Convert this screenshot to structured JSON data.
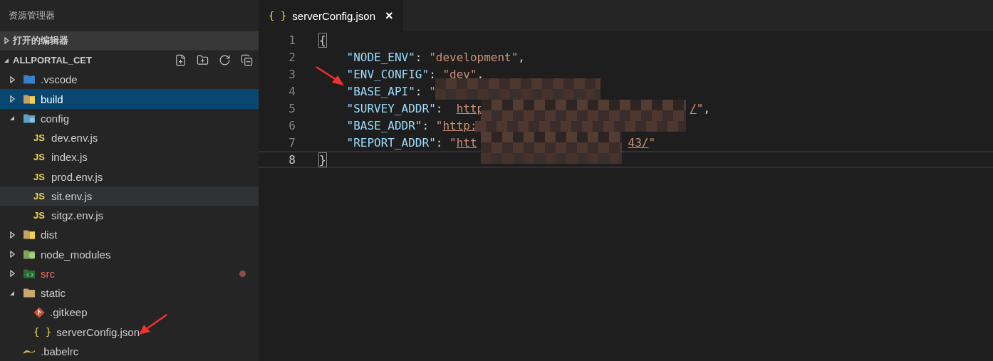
{
  "sidebar": {
    "title": "资源管理器",
    "sections": [
      {
        "label": "打开的编辑器",
        "expanded": false
      },
      {
        "label": "ALLPORTAL_CET",
        "expanded": true
      }
    ],
    "tree": [
      {
        "label": ".vscode",
        "kind": "vscode",
        "expanded": false,
        "selected": false,
        "hover": false,
        "modified": false
      },
      {
        "label": "build",
        "kind": "build",
        "expanded": false,
        "selected": true,
        "hover": false,
        "modified": false
      },
      {
        "label": "config",
        "kind": "config",
        "expanded": true,
        "selected": false,
        "hover": false,
        "modified": false,
        "children": [
          {
            "label": "dev.env.js",
            "kind": "js",
            "badge": "JS",
            "selected": false,
            "hover": false,
            "modified": false
          },
          {
            "label": "index.js",
            "kind": "js",
            "badge": "JS",
            "selected": false,
            "hover": false,
            "modified": false
          },
          {
            "label": "prod.env.js",
            "kind": "js",
            "badge": "JS",
            "selected": false,
            "hover": false,
            "modified": false
          },
          {
            "label": "sit.env.js",
            "kind": "js",
            "badge": "JS",
            "selected": false,
            "hover": true,
            "modified": false
          },
          {
            "label": "sitgz.env.js",
            "kind": "js",
            "badge": "JS",
            "selected": false,
            "hover": false,
            "modified": false
          }
        ]
      },
      {
        "label": "dist",
        "kind": "build",
        "expanded": false,
        "selected": false,
        "hover": false,
        "modified": false
      },
      {
        "label": "node_modules",
        "kind": "node",
        "expanded": false,
        "selected": false,
        "hover": false,
        "modified": false
      },
      {
        "label": "src",
        "kind": "src",
        "expanded": false,
        "selected": false,
        "hover": false,
        "modified": true
      },
      {
        "label": "static",
        "kind": "folder",
        "expanded": true,
        "selected": false,
        "hover": false,
        "modified": false,
        "children": [
          {
            "label": ".gitkeep",
            "kind": "git",
            "selected": false,
            "hover": false,
            "modified": false
          },
          {
            "label": "serverConfig.json",
            "kind": "json",
            "badge": "{ }",
            "selected": false,
            "hover": false,
            "modified": false
          }
        ]
      },
      {
        "label": ".babelrc",
        "kind": "babel",
        "selected": false,
        "hover": false,
        "modified": false
      }
    ]
  },
  "editor": {
    "tabs": [
      {
        "label": "serverConfig.json",
        "badge": "{ }",
        "selected": true,
        "close": "×"
      }
    ],
    "lines": [
      {
        "number": "1",
        "kind": "brace",
        "current": false,
        "before": [
          {
            "kind": "bracket",
            "text": "{"
          }
        ]
      },
      {
        "number": "2",
        "kind": "entry",
        "current": false,
        "before": [
          {
            "kind": "key",
            "text": "\"NODE_ENV\""
          },
          {
            "kind": "punct",
            "text": ": "
          },
          {
            "kind": "string",
            "text": "\"development\""
          },
          {
            "kind": "punct",
            "text": ","
          }
        ]
      },
      {
        "number": "3",
        "kind": "entry",
        "current": false,
        "before": [
          {
            "kind": "key",
            "text": "\"ENV_CONFIG\""
          },
          {
            "kind": "punct",
            "text": ": "
          },
          {
            "kind": "string",
            "text": "\"dev\""
          },
          {
            "kind": "punct",
            "text": ","
          }
        ]
      },
      {
        "number": "4",
        "kind": "entry",
        "current": false,
        "before": [
          {
            "kind": "key",
            "text": "\"BASE_API\""
          },
          {
            "kind": "punct",
            "text": ": "
          },
          {
            "kind": "string",
            "text": "\""
          }
        ]
      },
      {
        "number": "5",
        "kind": "entry",
        "current": false,
        "before": [
          {
            "kind": "key",
            "text": "\"SURVEY_ADDR\""
          },
          {
            "kind": "punct",
            "text": ":  "
          },
          {
            "kind": "link",
            "text": "http"
          }
        ],
        "after": [
          {
            "kind": "link",
            "text": "/"
          },
          {
            "kind": "string",
            "text": "\""
          },
          {
            "kind": "punct",
            "text": ","
          }
        ]
      },
      {
        "number": "6",
        "kind": "entry",
        "current": false,
        "before": [
          {
            "kind": "key",
            "text": "\"BASE_ADDR\""
          },
          {
            "kind": "punct",
            "text": ": "
          },
          {
            "kind": "string",
            "text": "\""
          },
          {
            "kind": "link",
            "text": "http:"
          }
        ]
      },
      {
        "number": "7",
        "kind": "entry",
        "current": false,
        "before": [
          {
            "kind": "key",
            "text": "\"REPORT_ADDR\""
          },
          {
            "kind": "punct",
            "text": ": "
          },
          {
            "kind": "string",
            "text": "\""
          },
          {
            "kind": "link",
            "text": "htt"
          }
        ],
        "after": [
          {
            "kind": "link",
            "text": "43/"
          },
          {
            "kind": "string",
            "text": "\""
          }
        ]
      },
      {
        "number": "8",
        "kind": "brace",
        "current": true,
        "before": [
          {
            "kind": "bracket",
            "text": "}"
          }
        ]
      }
    ]
  }
}
